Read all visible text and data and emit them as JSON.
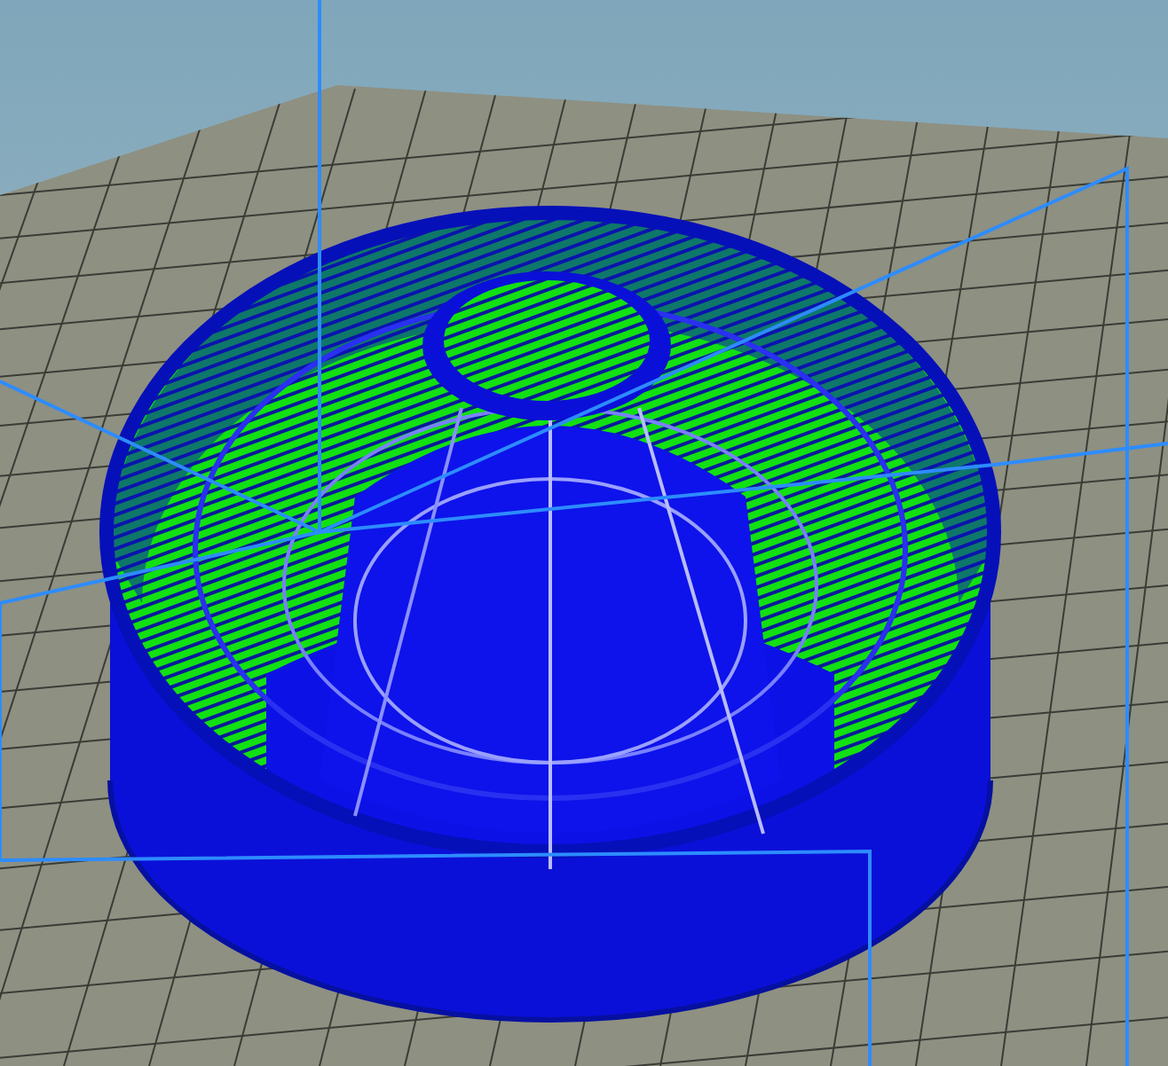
{
  "scene": {
    "kind": "slicer-preview"
  }
}
